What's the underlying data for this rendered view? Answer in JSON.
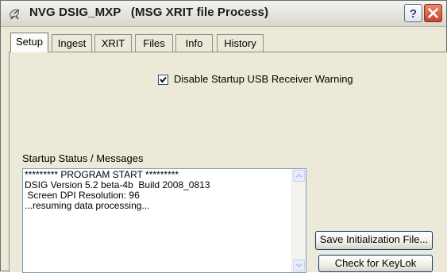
{
  "window": {
    "title": "NVG DSIG_MXP   (MSG XRIT file Process)",
    "help_icon": "question-mark-icon",
    "close_icon": "close-x-icon",
    "app_icon": "satellite-dish-icon"
  },
  "tabs": [
    {
      "label": "Setup",
      "active": true
    },
    {
      "label": "Ingest",
      "active": false
    },
    {
      "label": "XRIT",
      "active": false
    },
    {
      "label": "Files",
      "active": false
    },
    {
      "label": "Info",
      "active": false
    },
    {
      "label": "History",
      "active": false
    }
  ],
  "setup": {
    "disable_usb_warning": {
      "label": "Disable Startup USB Receiver Warning",
      "checked": true
    },
    "status_heading": "Startup Status / Messages",
    "messages": [
      "********* PROGRAM START *********",
      "DSIG Version 5.2 beta-4b  Build 2008_0813",
      " Screen DPI Resolution: 96",
      "...resuming data processing..."
    ],
    "save_button": "Save Initialization File...",
    "keylok_button": "Check for KeyLok"
  },
  "colors": {
    "panel_bg": "#ece9d8",
    "close_button": "#c8422a",
    "button_border": "#003c74"
  }
}
